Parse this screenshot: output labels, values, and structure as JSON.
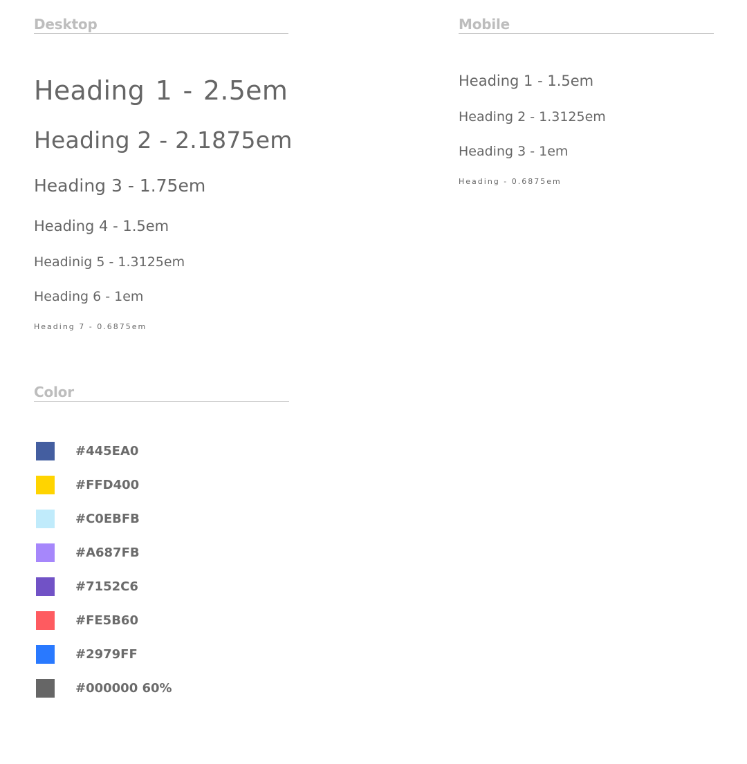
{
  "desktop": {
    "title": "Desktop",
    "headings": [
      "Heading 1  - 2.5em",
      "Heading 2 - 2.1875em",
      "Heading 3 - 1.75em",
      "Heading 4 - 1.5em",
      "Headinig 5 - 1.3125em",
      "Heading 6 - 1em",
      "Heading 7 - 0.6875em"
    ]
  },
  "mobile": {
    "title": "Mobile",
    "headings": [
      "Heading 1 - 1.5em",
      "Heading 2 - 1.3125em",
      "Heading 3 - 1em",
      "Heading - 0.6875em"
    ]
  },
  "color": {
    "title": "Color",
    "swatches": [
      {
        "label": "#445EA0",
        "hex": "#445EA0"
      },
      {
        "label": "#FFD400",
        "hex": "#FFD400"
      },
      {
        "label": "#C0EBFB",
        "hex": "#C0EBFB"
      },
      {
        "label": "#A687FB",
        "hex": "#A687FB"
      },
      {
        "label": "#7152C6",
        "hex": "#7152C6"
      },
      {
        "label": "#FE5B60",
        "hex": "#FE5B60"
      },
      {
        "label": "#2979FF",
        "hex": "#2979FF"
      },
      {
        "label": "#000000 60%",
        "hex": "#666666"
      }
    ]
  }
}
